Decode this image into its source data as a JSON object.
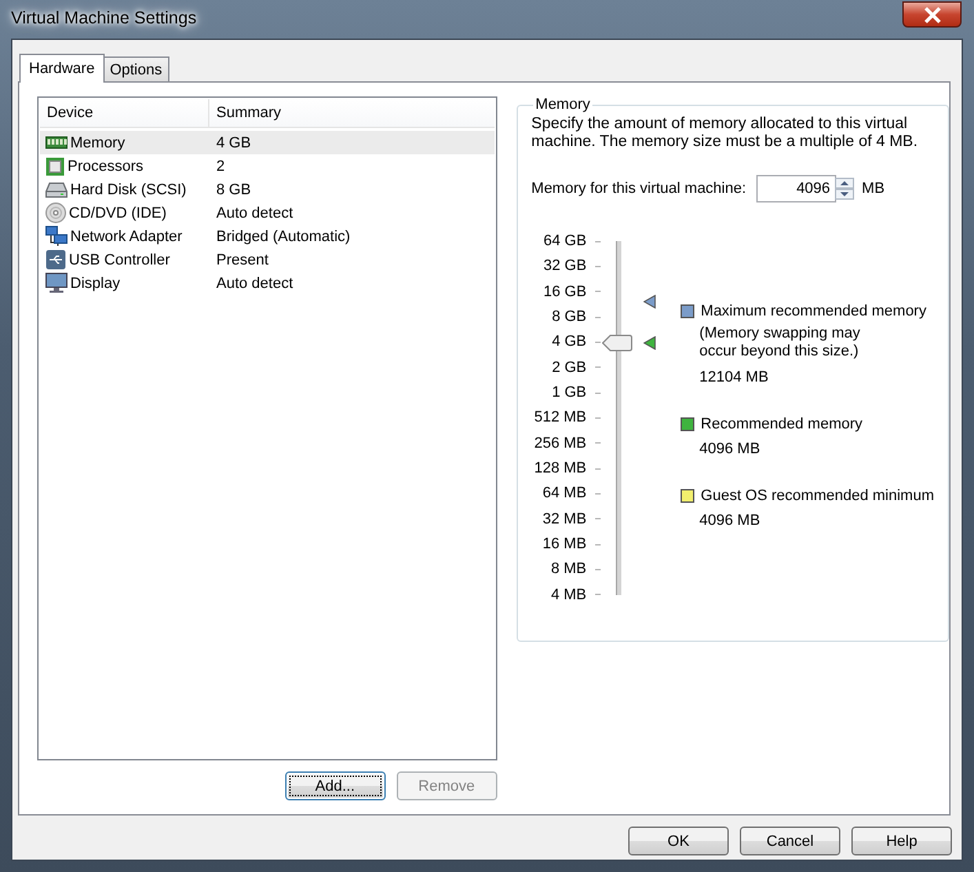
{
  "window": {
    "title": "Virtual Machine Settings"
  },
  "tabs": [
    {
      "label": "Hardware",
      "selected": true
    },
    {
      "label": "Options",
      "selected": false
    }
  ],
  "device_table": {
    "columns": [
      "Device",
      "Summary"
    ],
    "rows": [
      {
        "kind": "memory",
        "device": "Memory",
        "summary": "4 GB",
        "selected": true
      },
      {
        "kind": "processor",
        "device": "Processors",
        "summary": "2",
        "selected": false
      },
      {
        "kind": "disk",
        "device": "Hard Disk (SCSI)",
        "summary": "8 GB",
        "selected": false
      },
      {
        "kind": "cd",
        "device": "CD/DVD (IDE)",
        "summary": "Auto detect",
        "selected": false
      },
      {
        "kind": "network",
        "device": "Network Adapter",
        "summary": "Bridged (Automatic)",
        "selected": false
      },
      {
        "kind": "usb",
        "device": "USB Controller",
        "summary": "Present",
        "selected": false
      },
      {
        "kind": "display",
        "device": "Display",
        "summary": "Auto detect",
        "selected": false
      }
    ]
  },
  "device_buttons": [
    {
      "label": "Add...",
      "focused": true,
      "disabled": false
    },
    {
      "label": "Remove",
      "focused": false,
      "disabled": true
    }
  ],
  "memory": {
    "title": "Memory",
    "description": "Specify the amount of memory allocated to this virtual machine. The memory size must be a multiple of 4 MB.",
    "field_label": "Memory for this virtual machine:",
    "value": "4096",
    "unit": "MB",
    "slider": {
      "ticks": [
        "64 GB",
        "32 GB",
        "16 GB",
        "8 GB",
        "4 GB",
        "2 GB",
        "1 GB",
        "512 MB",
        "256 MB",
        "128 MB",
        "64 MB",
        "32 MB",
        "16 MB",
        "8 MB",
        "4 MB"
      ],
      "level": 0.714,
      "markers": [
        {
          "color": "#7b9cc9",
          "level": 0.829
        },
        {
          "color": "#3fb43f",
          "level": 0.714
        }
      ]
    },
    "legend": [
      {
        "label": "Maximum recommended memory",
        "note": "(Memory swapping may occur beyond this size.)",
        "value": "12104 MB",
        "color": "#7b9cc9"
      },
      {
        "label": "Recommended memory",
        "value": "4096 MB",
        "color": "#3fb43f"
      },
      {
        "label": "Guest OS recommended minimum",
        "value": "4096 MB",
        "color": "#f2ef6e"
      }
    ]
  },
  "buttons": [
    "OK",
    "Cancel",
    "Help"
  ]
}
